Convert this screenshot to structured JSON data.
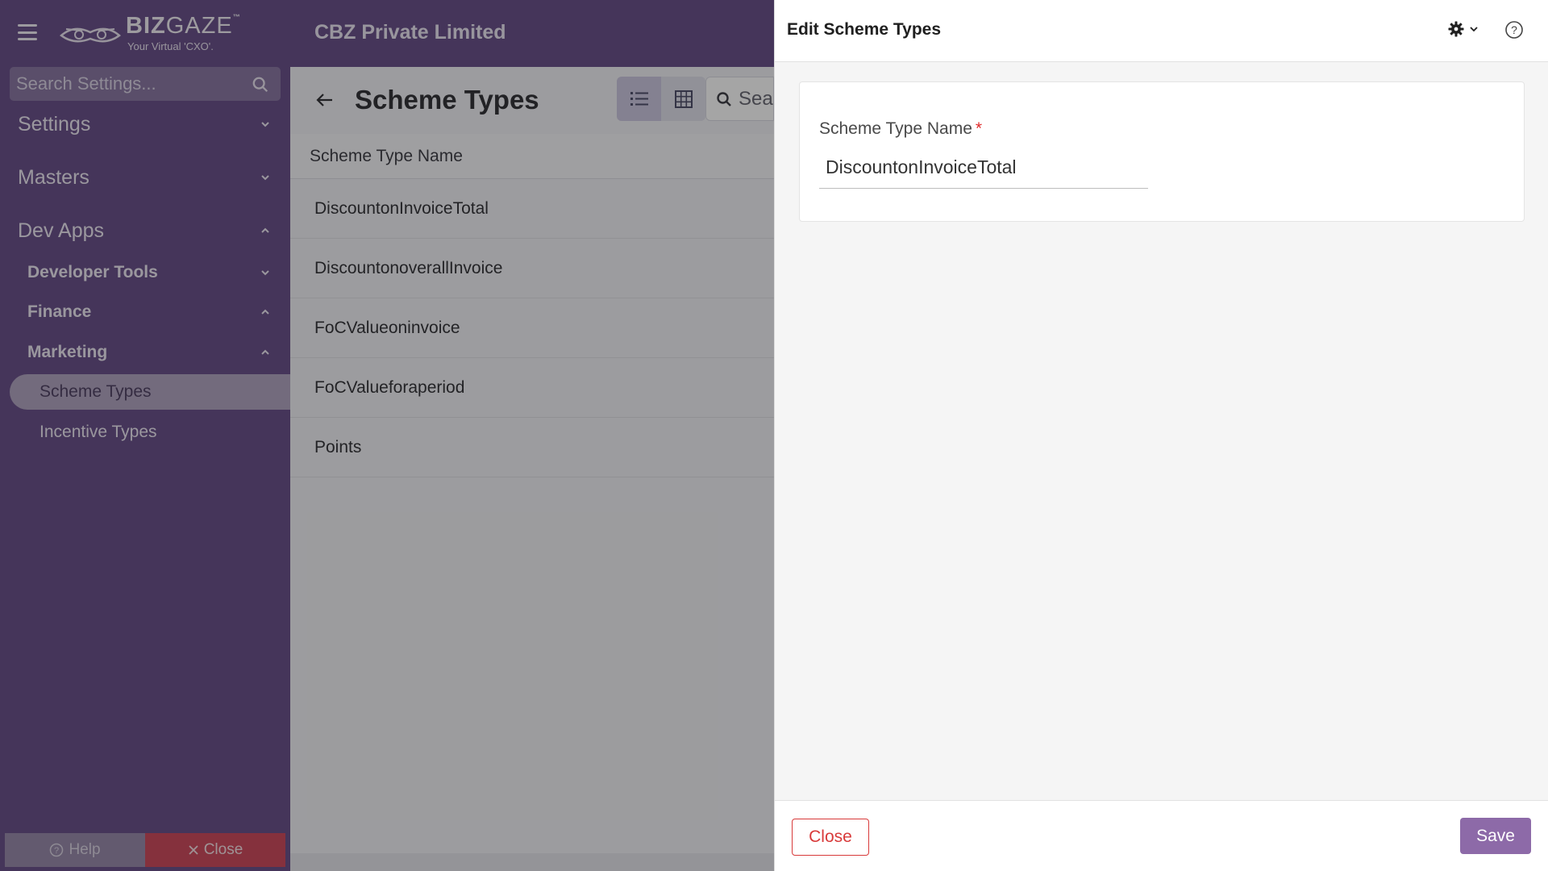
{
  "header": {
    "company": "CBZ Private Limited",
    "logo_word_bold": "BIZ",
    "logo_word_light": "GAZE",
    "logo_tm": "™",
    "logo_tagline": "Your Virtual 'CXO'."
  },
  "sidebar": {
    "search_placeholder": "Search Settings...",
    "items": [
      {
        "label": "Settings"
      },
      {
        "label": "Masters"
      },
      {
        "label": "Dev Apps"
      },
      {
        "label": "Developer Tools"
      },
      {
        "label": "Finance"
      },
      {
        "label": "Marketing"
      },
      {
        "label": "Scheme Types"
      },
      {
        "label": "Incentive Types"
      }
    ],
    "help_label": "Help",
    "close_label": "Close"
  },
  "list": {
    "title": "Scheme Types",
    "search_placeholder": "Sea",
    "column_header": "Scheme Type Name",
    "rows": [
      "DiscountonInvoiceTotal",
      "DiscountonoverallInvoice",
      "FoCValueoninvoice",
      "FoCValueforaperiod",
      "Points"
    ]
  },
  "panel": {
    "title": "Edit Scheme Types",
    "field_label": "Scheme Type Name",
    "required_mark": "*",
    "field_value": "DiscountonInvoiceTotal",
    "close_label": "Close",
    "save_label": "Save"
  },
  "colors": {
    "brand": "#5a3f7e",
    "save": "#8d6aa8",
    "danger": "#d83a3a"
  }
}
